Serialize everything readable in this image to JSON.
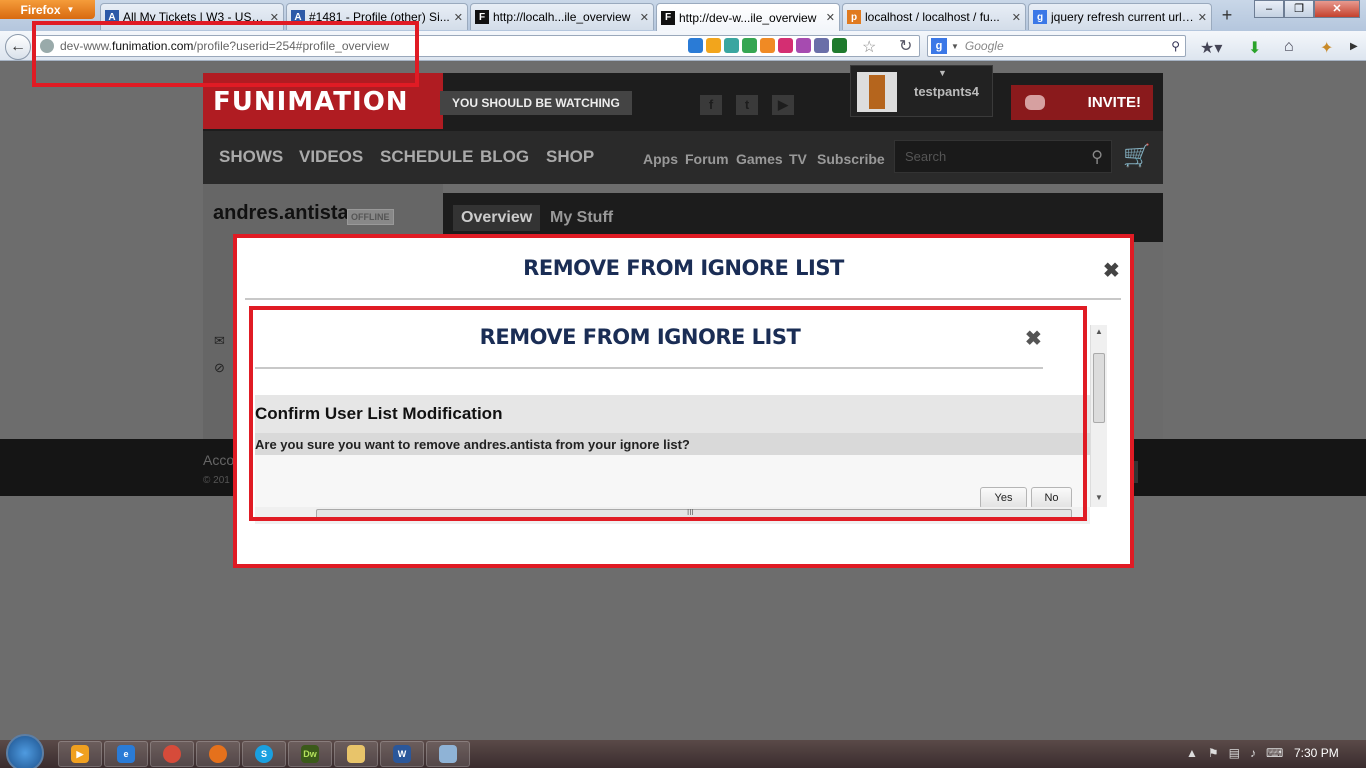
{
  "browser": {
    "app_button": "Firefox",
    "tabs": [
      {
        "label": "All My Tickets | W3 - USA...",
        "icon": "atlassian-icon",
        "active": false
      },
      {
        "label": "#1481 - Profile (other) Si...",
        "icon": "atlassian-icon",
        "active": false
      },
      {
        "label": "http://localh...ile_overview",
        "icon": "funimation-icon",
        "active": false
      },
      {
        "label": "http://dev-w...ile_overview",
        "icon": "funimation-icon",
        "active": true
      },
      {
        "label": "localhost / localhost / fu...",
        "icon": "phpmyadmin-icon",
        "active": false
      },
      {
        "label": "jquery refresh current url ...",
        "icon": "google-icon",
        "active": false
      }
    ],
    "url_prefix": "dev-www.",
    "url_domain": "funimation.com",
    "url_suffix": "/profile?userid=254#profile_overview",
    "search_placeholder": "Google"
  },
  "site": {
    "logo": "FUNIMATION",
    "watching": "YOU SHOULD BE WATCHING",
    "social": [
      "f",
      "t",
      "▶"
    ],
    "username": "testpants4",
    "invite": "INVITE!",
    "main_nav": [
      "SHOWS",
      "VIDEOS",
      "SCHEDULE",
      "BLOG",
      "SHOP"
    ],
    "sub_nav": [
      "Apps",
      "Forum",
      "Games",
      "TV",
      "Subscribe"
    ],
    "search_placeholder": "Search",
    "profile_name": "andres.antista",
    "status": "OFFLINE",
    "tabs": [
      "Overview",
      "My Stuff"
    ],
    "footer_link": "Acco",
    "footer_copy": "© 201"
  },
  "outer_modal": {
    "title": "REMOVE FROM IGNORE LIST",
    "close": "✖"
  },
  "inner_modal": {
    "title": "REMOVE FROM IGNORE LIST",
    "close": "✖",
    "confirm_title": "Confirm User List Modification",
    "confirm_message": "Are you sure you want to remove andres.antista from your ignore list?",
    "yes": "Yes",
    "no": "No",
    "hscroll_grip": "III"
  },
  "taskbar": {
    "time": "7:30 PM"
  },
  "colors": {
    "annotation_red": "#e01b24",
    "modal_title": "#1a2d55",
    "brand_red": "#b01c22"
  }
}
